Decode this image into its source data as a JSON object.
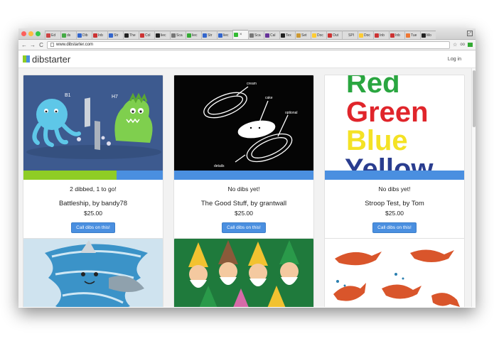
{
  "browser": {
    "tabs": [
      {
        "label": "Ed",
        "color": "#c44"
      },
      {
        "label": "ds",
        "color": "#4a4"
      },
      {
        "label": "Dib",
        "color": "#36c"
      },
      {
        "label": "Inb",
        "color": "#c33"
      },
      {
        "label": "Str",
        "color": "#36c"
      },
      {
        "label": "The",
        "color": "#222"
      },
      {
        "label": "Col",
        "color": "#c33"
      },
      {
        "label": "liec",
        "color": "#222"
      },
      {
        "label": "Sca",
        "color": "#777"
      },
      {
        "label": "liec",
        "color": "#3a3"
      },
      {
        "label": "Str",
        "color": "#36c"
      },
      {
        "label": "liec",
        "color": "#36c"
      },
      {
        "label": "",
        "color": "#3b3",
        "active": true
      },
      {
        "label": "Sca",
        "color": "#777"
      },
      {
        "label": "Cal",
        "color": "#639"
      },
      {
        "label": "Tex",
        "color": "#222"
      },
      {
        "label": "Set",
        "color": "#c93"
      },
      {
        "label": "Doc",
        "color": "#fc3"
      },
      {
        "label": "Out",
        "color": "#c33"
      },
      {
        "label": "SPI",
        "color": "#ddd"
      },
      {
        "label": "Doc",
        "color": "#fc3"
      },
      {
        "label": "Inb",
        "color": "#c33"
      },
      {
        "label": "Inb",
        "color": "#c33"
      },
      {
        "label": "Tue",
        "color": "#e73"
      },
      {
        "label": "Mo",
        "color": "#222"
      }
    ],
    "tab_close": "×",
    "url": "www.dibstarter.com",
    "back": "←",
    "forward": "→",
    "reload": "C",
    "star": "☆",
    "glasses": "👓"
  },
  "site": {
    "brand": "dibstarter",
    "login": "Log in",
    "logo_colors": [
      "#8fcd25",
      "#4a8fe0"
    ]
  },
  "cards": [
    {
      "status": "2 dibbed, 1 to go!",
      "title": "Battleship, by bandy78",
      "price": "$25.00",
      "button": "Call dibs on this!",
      "progress": 0.67,
      "image": "battleship",
      "labels": [
        "B1",
        "H7"
      ]
    },
    {
      "status": "No dibs yet!",
      "title": "The Good Stuff, by grantwall",
      "price": "$25.00",
      "button": "Call dibs on this!",
      "progress": 0,
      "image": "goodstuff",
      "labels": [
        "cream",
        "cake",
        "optional",
        "details"
      ]
    },
    {
      "status": "No dibs yet!",
      "title": "Stroop Test, by Tom",
      "price": "$25.00",
      "button": "Call dibs on this!",
      "progress": 0,
      "image": "stroop",
      "words": [
        "Red",
        "Green",
        "Blue",
        "Yellow"
      ]
    },
    {
      "image": "shark"
    },
    {
      "image": "gnomes"
    },
    {
      "image": "foxes"
    }
  ]
}
